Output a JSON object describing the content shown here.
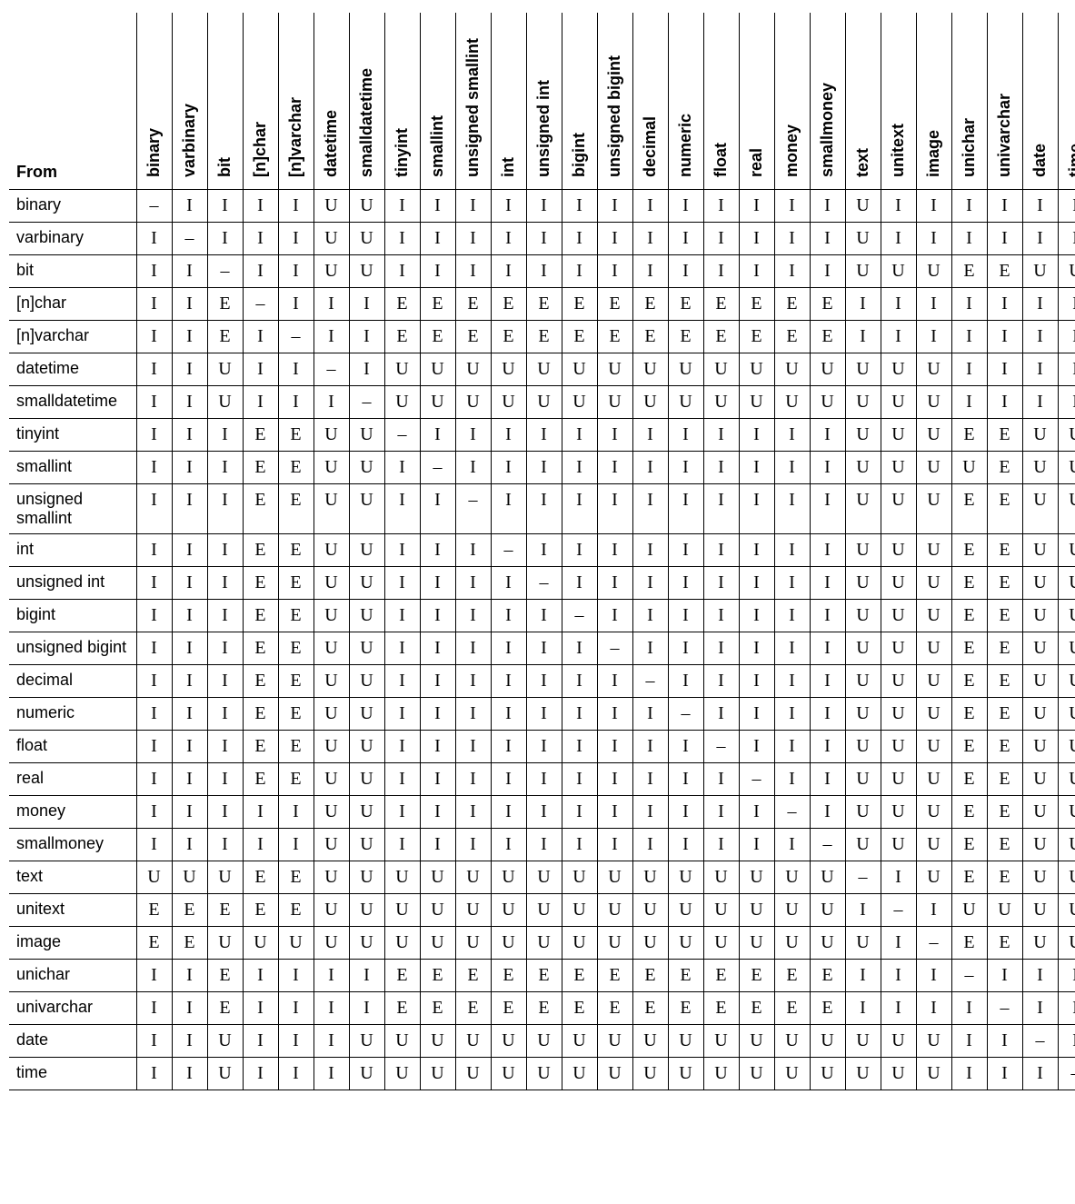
{
  "from_label": "From",
  "columns": [
    "binary",
    "varbinary",
    "bit",
    "[n]char",
    "[n]varchar",
    "datetime",
    "smalldatetime",
    "tinyint",
    "smallint",
    "unsigned smallint",
    "int",
    "unsigned int",
    "bigint",
    "unsigned bigint",
    "decimal",
    "numeric",
    "float",
    "real",
    "money",
    "smallmoney",
    "text",
    "unitext",
    "image",
    "unichar",
    "univarchar",
    "date",
    "time"
  ],
  "rows": [
    {
      "name": "binary",
      "cells": [
        "–",
        "I",
        "I",
        "I",
        "I",
        "U",
        "U",
        "I",
        "I",
        "I",
        "I",
        "I",
        "I",
        "I",
        "I",
        "I",
        "I",
        "I",
        "I",
        "I",
        "U",
        "I",
        "I",
        "I",
        "I",
        "I",
        "I"
      ]
    },
    {
      "name": "varbinary",
      "cells": [
        "I",
        "–",
        "I",
        "I",
        "I",
        "U",
        "U",
        "I",
        "I",
        "I",
        "I",
        "I",
        "I",
        "I",
        "I",
        "I",
        "I",
        "I",
        "I",
        "I",
        "U",
        "I",
        "I",
        "I",
        "I",
        "I",
        "I"
      ]
    },
    {
      "name": "bit",
      "cells": [
        "I",
        "I",
        "–",
        "I",
        "I",
        "U",
        "U",
        "I",
        "I",
        "I",
        "I",
        "I",
        "I",
        "I",
        "I",
        "I",
        "I",
        "I",
        "I",
        "I",
        "U",
        "U",
        "U",
        "E",
        "E",
        "U",
        "U"
      ]
    },
    {
      "name": "[n]char",
      "cells": [
        "I",
        "I",
        "E",
        "–",
        "I",
        "I",
        "I",
        "E",
        "E",
        "E",
        "E",
        "E",
        "E",
        "E",
        "E",
        "E",
        "E",
        "E",
        "E",
        "E",
        "I",
        "I",
        "I",
        "I",
        "I",
        "I",
        "I"
      ]
    },
    {
      "name": "[n]varchar",
      "cells": [
        "I",
        "I",
        "E",
        "I",
        "–",
        "I",
        "I",
        "E",
        "E",
        "E",
        "E",
        "E",
        "E",
        "E",
        "E",
        "E",
        "E",
        "E",
        "E",
        "E",
        "I",
        "I",
        "I",
        "I",
        "I",
        "I",
        "I"
      ]
    },
    {
      "name": "datetime",
      "cells": [
        "I",
        "I",
        "U",
        "I",
        "I",
        "–",
        "I",
        "U",
        "U",
        "U",
        "U",
        "U",
        "U",
        "U",
        "U",
        "U",
        "U",
        "U",
        "U",
        "U",
        "U",
        "U",
        "U",
        "I",
        "I",
        "I",
        "I"
      ]
    },
    {
      "name": "smalldatetime",
      "cells": [
        "I",
        "I",
        "U",
        "I",
        "I",
        "I",
        "–",
        "U",
        "U",
        "U",
        "U",
        "U",
        "U",
        "U",
        "U",
        "U",
        "U",
        "U",
        "U",
        "U",
        "U",
        "U",
        "U",
        "I",
        "I",
        "I",
        "I"
      ]
    },
    {
      "name": "tinyint",
      "cells": [
        "I",
        "I",
        "I",
        "E",
        "E",
        "U",
        "U",
        "–",
        "I",
        "I",
        "I",
        "I",
        "I",
        "I",
        "I",
        "I",
        "I",
        "I",
        "I",
        "I",
        "U",
        "U",
        "U",
        "E",
        "E",
        "U",
        "U"
      ]
    },
    {
      "name": "smallint",
      "cells": [
        "I",
        "I",
        "I",
        "E",
        "E",
        "U",
        "U",
        "I",
        "–",
        "I",
        "I",
        "I",
        "I",
        "I",
        "I",
        "I",
        "I",
        "I",
        "I",
        "I",
        "U",
        "U",
        "U",
        "U",
        "E",
        "U",
        "U"
      ]
    },
    {
      "name": "unsigned smallint",
      "cells": [
        "I",
        "I",
        "I",
        "E",
        "E",
        "U",
        "U",
        "I",
        "I",
        "–",
        "I",
        "I",
        "I",
        "I",
        "I",
        "I",
        "I",
        "I",
        "I",
        "I",
        "U",
        "U",
        "U",
        "E",
        "E",
        "U",
        "U"
      ]
    },
    {
      "name": "int",
      "cells": [
        "I",
        "I",
        "I",
        "E",
        "E",
        "U",
        "U",
        "I",
        "I",
        "I",
        "–",
        "I",
        "I",
        "I",
        "I",
        "I",
        "I",
        "I",
        "I",
        "I",
        "U",
        "U",
        "U",
        "E",
        "E",
        "U",
        "U"
      ]
    },
    {
      "name": "unsigned int",
      "cells": [
        "I",
        "I",
        "I",
        "E",
        "E",
        "U",
        "U",
        "I",
        "I",
        "I",
        "I",
        "–",
        "I",
        "I",
        "I",
        "I",
        "I",
        "I",
        "I",
        "I",
        "U",
        "U",
        "U",
        "E",
        "E",
        "U",
        "U"
      ]
    },
    {
      "name": "bigint",
      "cells": [
        "I",
        "I",
        "I",
        "E",
        "E",
        "U",
        "U",
        "I",
        "I",
        "I",
        "I",
        "I",
        "–",
        "I",
        "I",
        "I",
        "I",
        "I",
        "I",
        "I",
        "U",
        "U",
        "U",
        "E",
        "E",
        "U",
        "U"
      ]
    },
    {
      "name": "unsigned bigint",
      "cells": [
        "I",
        "I",
        "I",
        "E",
        "E",
        "U",
        "U",
        "I",
        "I",
        "I",
        "I",
        "I",
        "I",
        "–",
        "I",
        "I",
        "I",
        "I",
        "I",
        "I",
        "U",
        "U",
        "U",
        "E",
        "E",
        "U",
        "U"
      ]
    },
    {
      "name": "decimal",
      "cells": [
        "I",
        "I",
        "I",
        "E",
        "E",
        "U",
        "U",
        "I",
        "I",
        "I",
        "I",
        "I",
        "I",
        "I",
        "–",
        "I",
        "I",
        "I",
        "I",
        "I",
        "U",
        "U",
        "U",
        "E",
        "E",
        "U",
        "U"
      ]
    },
    {
      "name": "numeric",
      "cells": [
        "I",
        "I",
        "I",
        "E",
        "E",
        "U",
        "U",
        "I",
        "I",
        "I",
        "I",
        "I",
        "I",
        "I",
        "I",
        "–",
        "I",
        "I",
        "I",
        "I",
        "U",
        "U",
        "U",
        "E",
        "E",
        "U",
        "U"
      ]
    },
    {
      "name": "float",
      "cells": [
        "I",
        "I",
        "I",
        "E",
        "E",
        "U",
        "U",
        "I",
        "I",
        "I",
        "I",
        "I",
        "I",
        "I",
        "I",
        "I",
        "–",
        "I",
        "I",
        "I",
        "U",
        "U",
        "U",
        "E",
        "E",
        "U",
        "U"
      ]
    },
    {
      "name": "real",
      "cells": [
        "I",
        "I",
        "I",
        "E",
        "E",
        "U",
        "U",
        "I",
        "I",
        "I",
        "I",
        "I",
        "I",
        "I",
        "I",
        "I",
        "I",
        "–",
        "I",
        "I",
        "U",
        "U",
        "U",
        "E",
        "E",
        "U",
        "U"
      ]
    },
    {
      "name": "money",
      "cells": [
        "I",
        "I",
        "I",
        "I",
        "I",
        "U",
        "U",
        "I",
        "I",
        "I",
        "I",
        "I",
        "I",
        "I",
        "I",
        "I",
        "I",
        "I",
        "–",
        "I",
        "U",
        "U",
        "U",
        "E",
        "E",
        "U",
        "U"
      ]
    },
    {
      "name": "smallmoney",
      "cells": [
        "I",
        "I",
        "I",
        "I",
        "I",
        "U",
        "U",
        "I",
        "I",
        "I",
        "I",
        "I",
        "I",
        "I",
        "I",
        "I",
        "I",
        "I",
        "I",
        "–",
        "U",
        "U",
        "U",
        "E",
        "E",
        "U",
        "U"
      ]
    },
    {
      "name": "text",
      "cells": [
        "U",
        "U",
        "U",
        "E",
        "E",
        "U",
        "U",
        "U",
        "U",
        "U",
        "U",
        "U",
        "U",
        "U",
        "U",
        "U",
        "U",
        "U",
        "U",
        "U",
        "–",
        "I",
        "U",
        "E",
        "E",
        "U",
        "U"
      ]
    },
    {
      "name": "unitext",
      "cells": [
        "E",
        "E",
        "E",
        "E",
        "E",
        "U",
        "U",
        "U",
        "U",
        "U",
        "U",
        "U",
        "U",
        "U",
        "U",
        "U",
        "U",
        "U",
        "U",
        "U",
        "I",
        "–",
        "I",
        "U",
        "U",
        "U",
        "U"
      ]
    },
    {
      "name": "image",
      "cells": [
        "E",
        "E",
        "U",
        "U",
        "U",
        "U",
        "U",
        "U",
        "U",
        "U",
        "U",
        "U",
        "U",
        "U",
        "U",
        "U",
        "U",
        "U",
        "U",
        "U",
        "U",
        "I",
        "–",
        "E",
        "E",
        "U",
        "U"
      ]
    },
    {
      "name": "unichar",
      "cells": [
        "I",
        "I",
        "E",
        "I",
        "I",
        "I",
        "I",
        "E",
        "E",
        "E",
        "E",
        "E",
        "E",
        "E",
        "E",
        "E",
        "E",
        "E",
        "E",
        "E",
        "I",
        "I",
        "I",
        "–",
        "I",
        "I",
        "I"
      ]
    },
    {
      "name": "univarchar",
      "cells": [
        "I",
        "I",
        "E",
        "I",
        "I",
        "I",
        "I",
        "E",
        "E",
        "E",
        "E",
        "E",
        "E",
        "E",
        "E",
        "E",
        "E",
        "E",
        "E",
        "E",
        "I",
        "I",
        "I",
        "I",
        "–",
        "I",
        "I"
      ]
    },
    {
      "name": "date",
      "cells": [
        "I",
        "I",
        "U",
        "I",
        "I",
        "I",
        "U",
        "U",
        "U",
        "U",
        "U",
        "U",
        "U",
        "U",
        "U",
        "U",
        "U",
        "U",
        "U",
        "U",
        "U",
        "U",
        "U",
        "I",
        "I",
        "–",
        "I"
      ]
    },
    {
      "name": "time",
      "cells": [
        "I",
        "I",
        "U",
        "I",
        "I",
        "I",
        "U",
        "U",
        "U",
        "U",
        "U",
        "U",
        "U",
        "U",
        "U",
        "U",
        "U",
        "U",
        "U",
        "U",
        "U",
        "U",
        "U",
        "I",
        "I",
        "I",
        "–"
      ]
    }
  ]
}
